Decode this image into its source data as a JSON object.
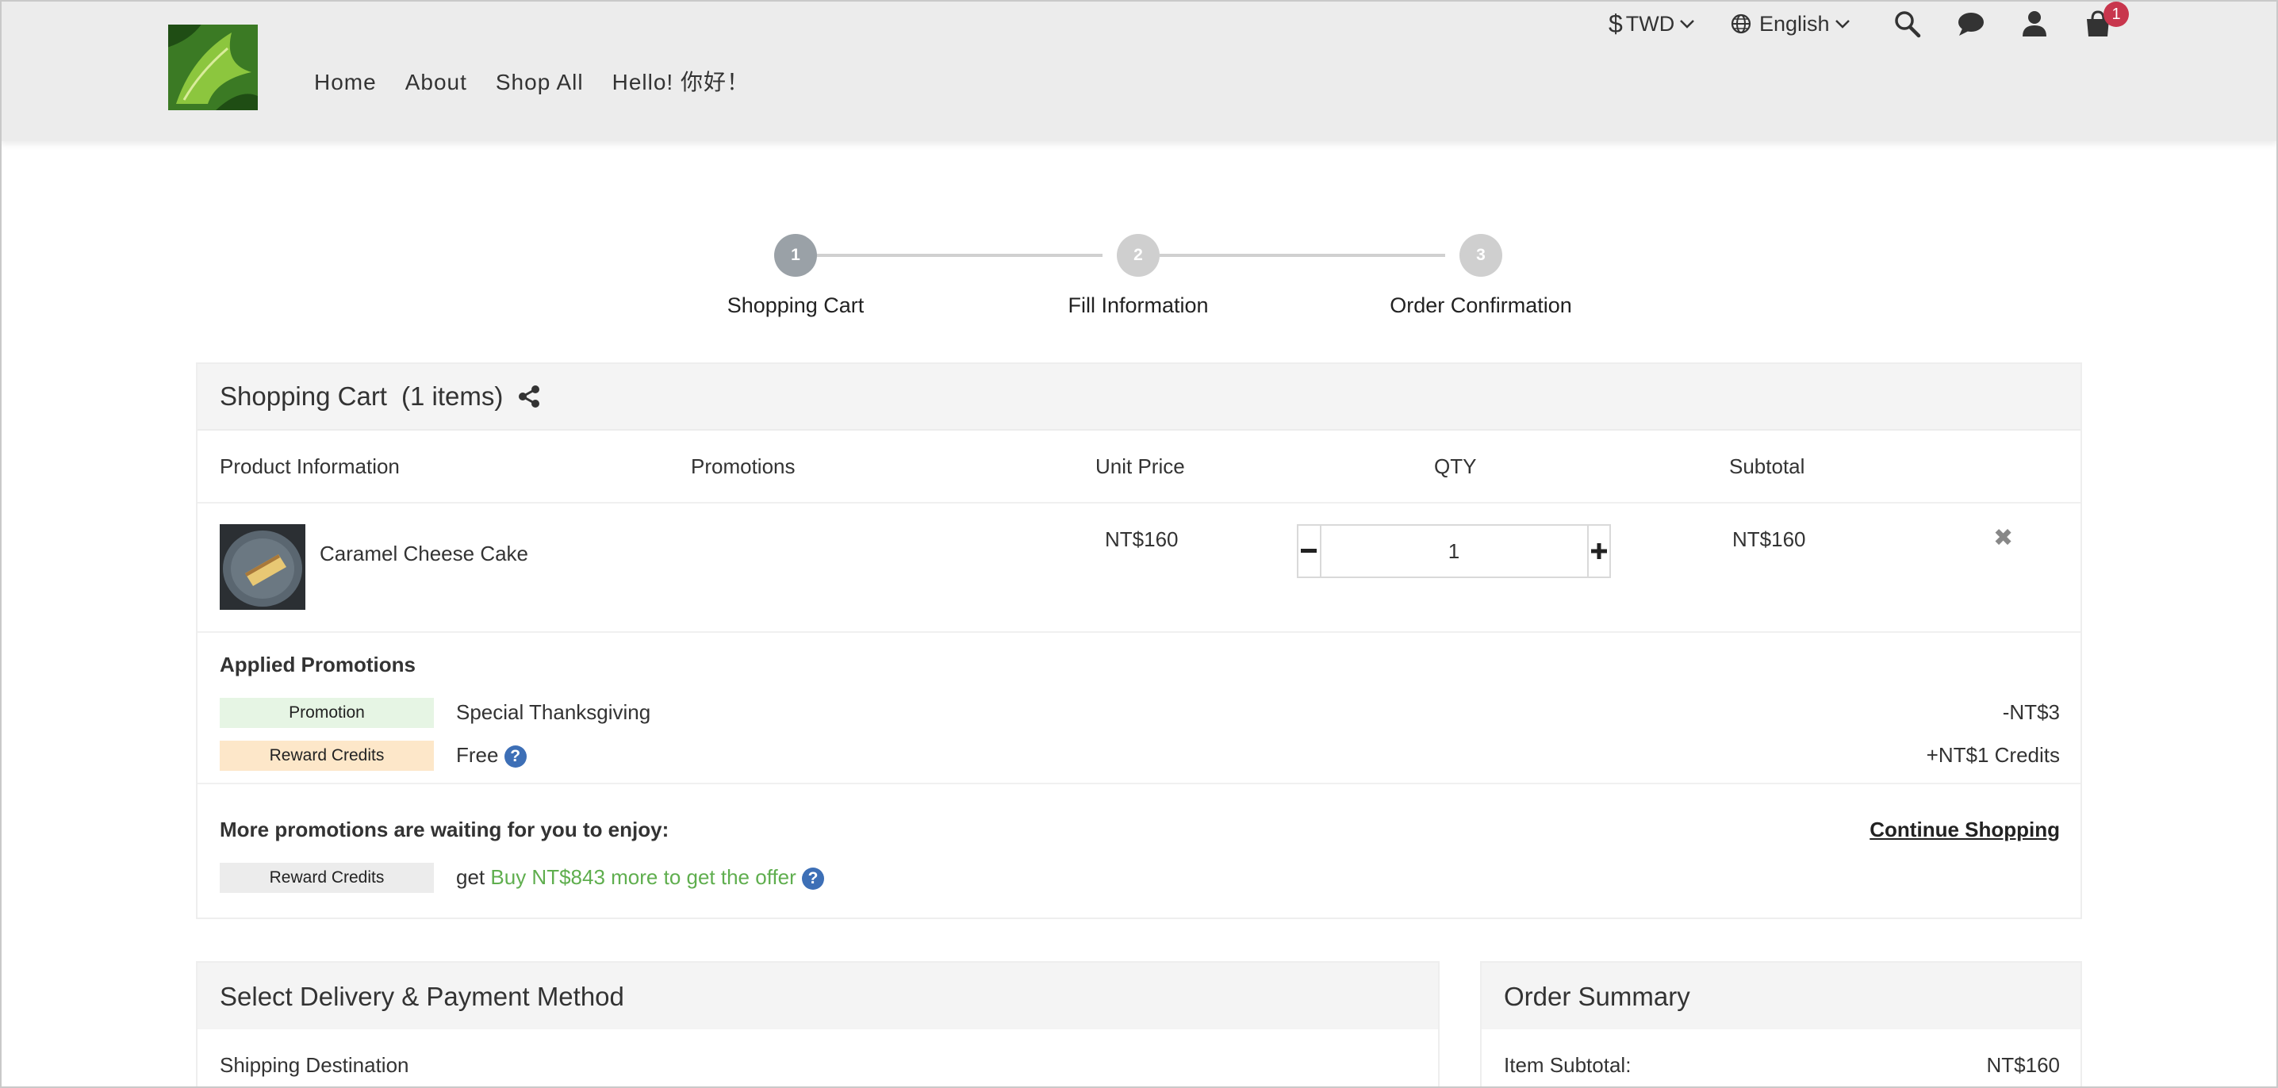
{
  "header": {
    "nav": [
      "Home",
      "About",
      "Shop All",
      "Hello! 你好！"
    ],
    "currency": "TWD",
    "currency_symbol": "$",
    "language": "English",
    "cart_count": "1",
    "icons": [
      "dollar-icon",
      "chevron-down-icon",
      "globe-icon",
      "search-icon",
      "chat-icon",
      "user-icon",
      "cart-icon"
    ]
  },
  "steps": [
    {
      "number": "1",
      "label": "Shopping Cart"
    },
    {
      "number": "2",
      "label": "Fill Information"
    },
    {
      "number": "3",
      "label": "Order Confirmation"
    }
  ],
  "cart": {
    "title": "Shopping Cart",
    "count_text": "(1 items)",
    "columns": {
      "product": "Product Information",
      "promotions": "Promotions",
      "unit_price": "Unit Price",
      "qty": "QTY",
      "subtotal": "Subtotal"
    },
    "item": {
      "name": "Caramel Cheese Cake",
      "unit_price": "NT$160",
      "qty": "1",
      "subtotal": "NT$160",
      "remove_symbol": "✖"
    },
    "applied_title": "Applied Promotions",
    "applied": [
      {
        "tag": "Promotion",
        "desc": "Special Thanksgiving",
        "amount": "-NT$3"
      },
      {
        "tag": "Reward Credits",
        "desc": "Free",
        "amount": "+NT$1 Credits"
      }
    ],
    "more_title": "More promotions are waiting for you to enjoy:",
    "continue_label": "Continue Shopping",
    "more": {
      "tag": "Reward Credits",
      "prefix": "get",
      "offer": "Buy NT$843 more to get the offer"
    },
    "help_symbol": "?"
  },
  "delivery": {
    "title": "Select Delivery & Payment Method",
    "shipping_label": "Shipping Destination"
  },
  "summary": {
    "title": "Order Summary",
    "item_subtotal_label": "Item Subtotal:",
    "item_subtotal_value": "NT$160"
  },
  "colors": {
    "step_active": "#9aa1a7",
    "step_inactive": "#cfcfcf",
    "promotion_tag": "#e6f5e4",
    "reward_tag": "#fde7c9",
    "more_tag": "#ececec",
    "offer_green": "#5fae4e",
    "badge": "#c8364d"
  }
}
